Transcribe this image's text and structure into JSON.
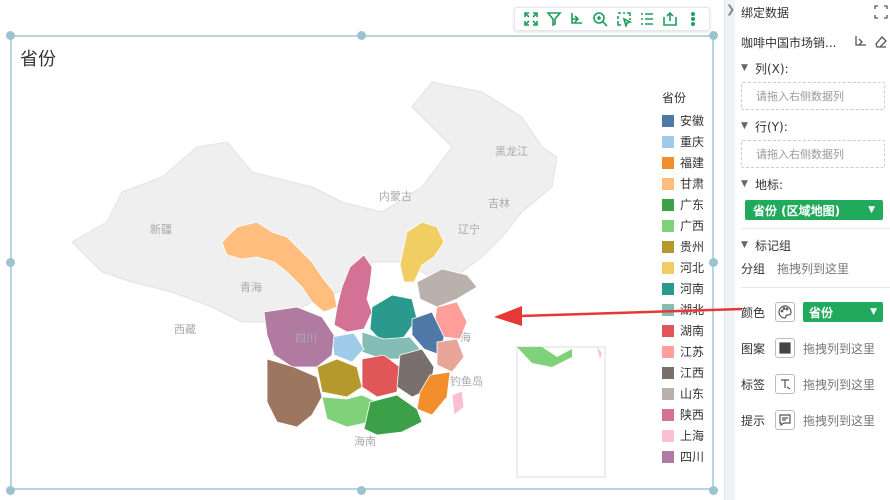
{
  "toolbar": {
    "buttons": [
      {
        "name": "fullscreen-icon"
      },
      {
        "name": "filter-icon"
      },
      {
        "name": "drill-icon"
      },
      {
        "name": "zoom-in-icon"
      },
      {
        "name": "select-icon"
      },
      {
        "name": "list-icon"
      },
      {
        "name": "export-icon"
      },
      {
        "name": "more-icon"
      }
    ]
  },
  "chart": {
    "title": "省份",
    "background_labels": [
      "黑龙江",
      "内蒙古",
      "吉林",
      "新疆",
      "辽宁",
      "青海",
      "西藏",
      "海南",
      "钓鱼岛"
    ],
    "map_labels": [
      "四川",
      "海"
    ],
    "legend": {
      "title": "省份",
      "items": [
        {
          "label": "安徽",
          "color": "#4e79a7"
        },
        {
          "label": "重庆",
          "color": "#a0cbe8"
        },
        {
          "label": "福建",
          "color": "#f28e2b"
        },
        {
          "label": "甘肃",
          "color": "#ffbe7d"
        },
        {
          "label": "广东",
          "color": "#3ba047"
        },
        {
          "label": "广西",
          "color": "#7fd17a"
        },
        {
          "label": "贵州",
          "color": "#b6992d"
        },
        {
          "label": "河北",
          "color": "#f1ce63"
        },
        {
          "label": "河南",
          "color": "#2b9a8e"
        },
        {
          "label": "湖北",
          "color": "#86bcb6"
        },
        {
          "label": "湖南",
          "color": "#e15759"
        },
        {
          "label": "江苏",
          "color": "#ff9d9a"
        },
        {
          "label": "江西",
          "color": "#79706e"
        },
        {
          "label": "山东",
          "color": "#bab0ac"
        },
        {
          "label": "陕西",
          "color": "#d37295"
        },
        {
          "label": "上海",
          "color": "#fabfd2"
        },
        {
          "label": "四川",
          "color": "#b07aa1"
        }
      ]
    },
    "extra_colors": {
      "yunnan": "#9d7660",
      "zhejiang": "#e8a598",
      "hainan": "#ddd"
    }
  },
  "panel": {
    "title": "绑定数据",
    "dataset_name": "咖啡中国市场销...",
    "column_label": "列(X):",
    "row_label": "行(Y):",
    "drop_placeholder": "请拖入右侧数据列",
    "geo_label": "地标:",
    "geo_pill": "省份 (区域地图)",
    "marks_label": "标记组",
    "group_label": "分组",
    "group_drop": "拖拽列到这里",
    "color_label": "颜色",
    "color_pill": "省份",
    "pattern_label": "图案",
    "label_label": "标签",
    "tooltip_label": "提示",
    "drag_here": "拖拽列到这里"
  }
}
